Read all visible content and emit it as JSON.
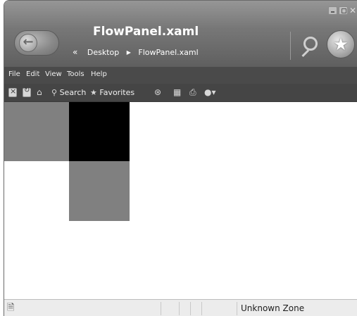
{
  "window": {
    "title": "FlowPanel.xaml",
    "breadcrumb": {
      "prefix": "«",
      "items": [
        "Desktop",
        "FlowPanel.xaml"
      ]
    },
    "controls": [
      "minimize-icon",
      "maximize-icon",
      "close-icon"
    ]
  },
  "menu": {
    "items": [
      "File",
      "Edit",
      "View",
      "Tools",
      "Help"
    ]
  },
  "command_bar": {
    "search_label": "Search",
    "favorites_label": "Favorites",
    "icons": [
      "stop-icon",
      "refresh-icon",
      "home-icon",
      "search-icon",
      "favorites-star-icon",
      "media-icon",
      "history-icon",
      "print-icon",
      "messenger-icon"
    ]
  },
  "content": {
    "panels": [
      {
        "name": "gray-panel-left",
        "color": "#808080"
      },
      {
        "name": "black-panel",
        "color": "#000000"
      },
      {
        "name": "gray-panel-below",
        "color": "#808080"
      }
    ]
  },
  "status": {
    "zone": "Unknown Zone"
  },
  "colors": {
    "titlebar": "#767676",
    "menubar": "#4a4a4a",
    "statusbar": "#ececec"
  }
}
